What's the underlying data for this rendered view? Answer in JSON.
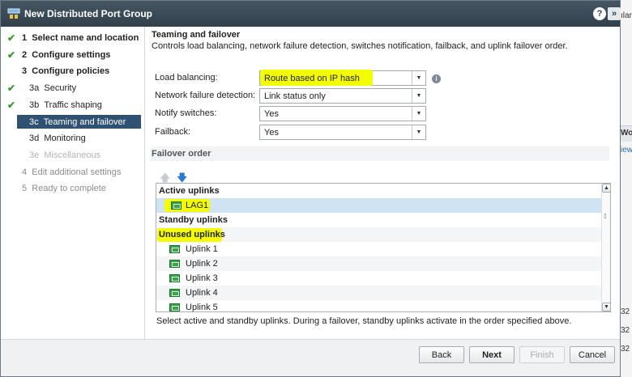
{
  "window": {
    "title": "New Distributed Port Group"
  },
  "nav": {
    "items": [
      {
        "num": "1",
        "label": "Select name and location",
        "checked": true,
        "style": "bold"
      },
      {
        "num": "2",
        "label": "Configure settings",
        "checked": true,
        "style": "bold"
      },
      {
        "num": "3",
        "label": "Configure policies",
        "checked": false,
        "style": "bold"
      },
      {
        "num": "3a",
        "label": "Security",
        "checked": true,
        "style": "normal"
      },
      {
        "num": "3b",
        "label": "Traffic shaping",
        "checked": true,
        "style": "normal"
      },
      {
        "num": "3c",
        "label": "Teaming and failover",
        "checked": false,
        "style": "selected"
      },
      {
        "num": "3d",
        "label": "Monitoring",
        "checked": false,
        "style": "normal"
      },
      {
        "num": "3e",
        "label": "Miscellaneous",
        "checked": false,
        "style": "disabled"
      },
      {
        "num": "4",
        "label": "Edit additional settings",
        "checked": false,
        "style": "gray"
      },
      {
        "num": "5",
        "label": "Ready to complete",
        "checked": false,
        "style": "gray"
      }
    ]
  },
  "section": {
    "title": "Teaming and failover",
    "description": "Controls load balancing, network failure detection, switches notification, failback, and uplink failover order."
  },
  "form": {
    "load_balancing": {
      "label": "Load balancing:",
      "value": "Route based on IP hash"
    },
    "network_failure_detection": {
      "label": "Network failure detection:",
      "value": "Link status only"
    },
    "notify_switches": {
      "label": "Notify switches:",
      "value": "Yes"
    },
    "failback": {
      "label": "Failback:",
      "value": "Yes"
    }
  },
  "failover": {
    "header": "Failover order",
    "rows": [
      {
        "label": "Active uplinks",
        "type": "header"
      },
      {
        "label": "LAG1",
        "type": "item"
      },
      {
        "label": "Standby uplinks",
        "type": "header"
      },
      {
        "label": "Unused uplinks",
        "type": "header"
      },
      {
        "label": "Uplink 1",
        "type": "item"
      },
      {
        "label": "Uplink 2",
        "type": "item"
      },
      {
        "label": "Uplink 3",
        "type": "item"
      },
      {
        "label": "Uplink 4",
        "type": "item"
      },
      {
        "label": "Uplink 5",
        "type": "item"
      }
    ],
    "hint": "Select active and standby uplinks. During a failover, standby uplinks activate in the order specified above."
  },
  "buttons": {
    "back": "Back",
    "next": "Next",
    "finish": "Finish",
    "cancel": "Cancel"
  },
  "background": {
    "fragments": [
      "ıları",
      "Wor",
      "iew",
      "32",
      "32",
      "32"
    ]
  },
  "colors": {
    "titlebar": "#3b4a56",
    "selected_nav": "#2f5273",
    "highlight": "#f3ff00",
    "check": "#3a9a2f",
    "uplink_icon": "#3aa34c"
  }
}
